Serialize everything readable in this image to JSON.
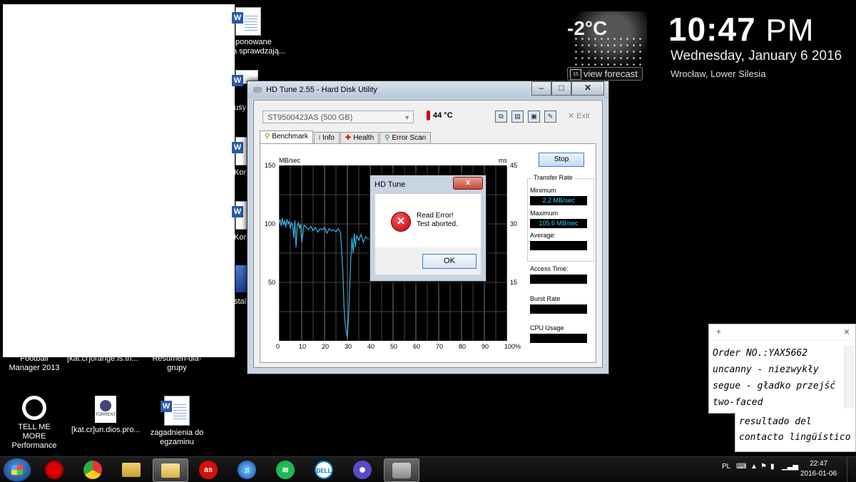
{
  "desktop": {
    "icons": [
      {
        "label": "Football Manager 2013"
      },
      {
        "label": "[kat.cr]orange.is.th..."
      },
      {
        "label": "Resumen-dla-grupy"
      },
      {
        "label": "TELL ME MORE Performance"
      },
      {
        "label": "[kat.cr]un.dios.pro..."
      },
      {
        "label": "zagadnienia do egzaminu"
      }
    ],
    "partial_labels": [
      "ponowane",
      "a sprawdzają...",
      "usy",
      "Korp",
      "Korp",
      "stall"
    ],
    "torrent_tag": "TORRENT"
  },
  "weather": {
    "temperature": "-2°C",
    "forecast_label": "view forecast",
    "forecast_day": "15"
  },
  "clock_widget": {
    "time": "10:47",
    "ampm": "PM",
    "date": "Wednesday, January 6 2016",
    "location": "Wrocław, Lower Silesia"
  },
  "hdtune": {
    "title": "HD Tune 2.55 - Hard Disk Utility",
    "drive": "ST9500423AS (500 GB)",
    "temperature": "44 °C",
    "exit_label": "Exit",
    "tabs": [
      {
        "label": "Benchmark"
      },
      {
        "label": "Info"
      },
      {
        "label": "Health"
      },
      {
        "label": "Error Scan"
      }
    ],
    "stop_label": "Stop",
    "transfer_rate_label": "Transfer Rate",
    "minimum_label": "Minimum",
    "minimum_value": "2.2 MB/sec",
    "maximum_label": "Maximum",
    "maximum_value": "105.6 MB/sec",
    "average_label": "Average:",
    "access_time_label": "Access Time:",
    "burst_rate_label": "Burst Rate",
    "cpu_usage_label": "CPU Usage"
  },
  "chart_data": {
    "type": "line",
    "ylabel": "MB/sec",
    "y2label": "ms",
    "ylim": [
      0,
      150
    ],
    "y2lim": [
      0,
      45
    ],
    "yticks": [
      "150",
      "100",
      "50"
    ],
    "y2ticks": [
      "45",
      "30",
      "15"
    ],
    "xticks": [
      "0",
      "10",
      "20",
      "30",
      "40",
      "50",
      "60",
      "70",
      "80",
      "90",
      "100%"
    ],
    "xlim": [
      0,
      100
    ],
    "grid": true,
    "line_color": "#33b5e5",
    "series": [
      {
        "x": [
          0,
          0.5,
          1,
          1.5,
          2,
          2.5,
          3,
          3.5,
          4,
          4.5,
          5,
          5.5,
          6,
          6.5,
          7,
          7.5,
          8,
          8.5,
          9,
          9.5,
          10,
          11,
          12,
          13,
          14,
          15,
          16,
          17,
          18,
          19,
          20,
          21,
          22,
          23,
          24,
          25,
          26,
          27,
          28,
          28.5,
          29,
          29.5,
          30,
          30.5,
          31,
          31.5,
          32,
          32.5,
          33,
          33.5,
          34,
          35,
          36,
          37,
          38,
          39,
          40,
          41
        ],
        "y": [
          100,
          104,
          98,
          105,
          99,
          103,
          97,
          104,
          100,
          102,
          96,
          101,
          99,
          88,
          103,
          80,
          98,
          101,
          96,
          100,
          84,
          99,
          97,
          95,
          98,
          94,
          97,
          93,
          96,
          95,
          97,
          92,
          96,
          94,
          95,
          93,
          96,
          92,
          60,
          30,
          15,
          8,
          2.2,
          20,
          45,
          70,
          88,
          75,
          92,
          80,
          90,
          86,
          91,
          84,
          89,
          87,
          88,
          86
        ]
      }
    ]
  },
  "dialog": {
    "title": "HD Tune",
    "close_label": "x",
    "message_line1": "Read Error!",
    "message_line2": "Test aborted.",
    "ok_label": "OK"
  },
  "sticky_note": {
    "add_label": "+",
    "close_label": "×",
    "lines": [
      "Order NO.:YAX5662",
      "uncanny - niezwykły",
      "segue - gładko przejść",
      "two-faced",
      "resultado del",
      "contacto lingüístico"
    ]
  },
  "taskbar": {
    "language": "PL",
    "time": "22:47",
    "date": "2016-01-06",
    "apps": [
      "Opera",
      "Chrome",
      "Explorer",
      "Folder",
      "Last.fm",
      "iTunes",
      "Spotify",
      "Dell",
      "Media",
      "HD Tune"
    ]
  }
}
